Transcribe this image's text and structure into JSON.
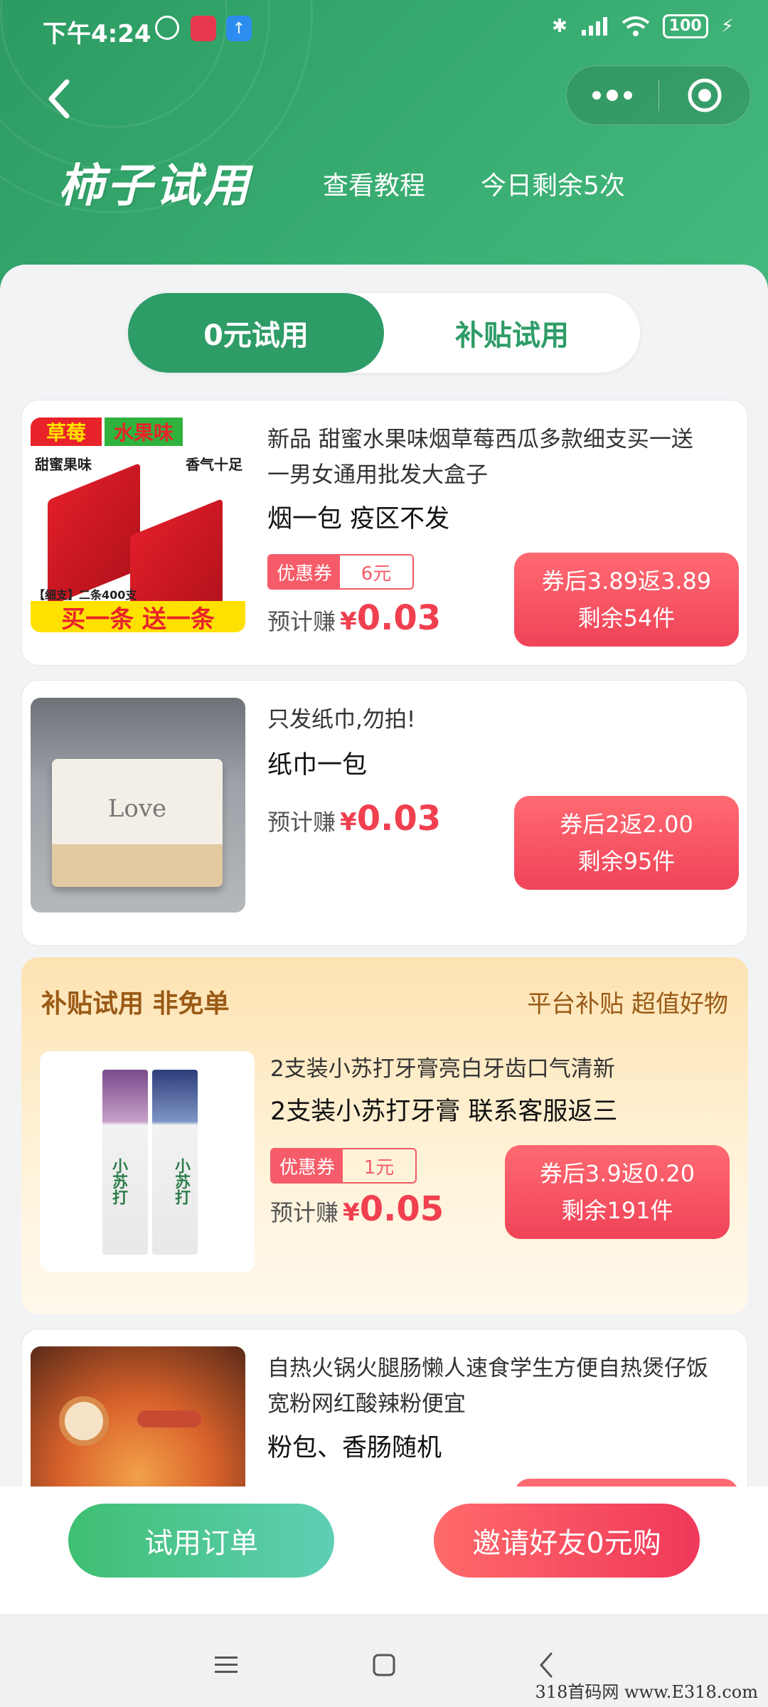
{
  "status_bar": {
    "time": "下午4:24",
    "battery": "100"
  },
  "header": {
    "brand": "柿子试用",
    "tutorial_link": "查看教程",
    "remaining_today": "今日剩余5次"
  },
  "tabs": [
    {
      "label": "0元试用",
      "active": true
    },
    {
      "label": "补贴试用",
      "active": false
    }
  ],
  "products": [
    {
      "title_line1": "新品 甜蜜水果味烟草莓西瓜多款细支买一送",
      "title_line2": "一男女通用批发大盒子",
      "subtitle": "烟一包 疫区不发",
      "coupon_label": "优惠券",
      "coupon_value": "6元",
      "earn_label": "预计赚",
      "currency": "¥",
      "earn_amount": "0.03",
      "btn_line1": "券后3.89返3.89",
      "btn_line2": "剩余54件",
      "image": {
        "tag1": "草莓",
        "tag2": "水果味",
        "left_text": "甜蜜果味",
        "right_text": "香气十足",
        "bottom_small": "【细支】二条400支",
        "banner": "买一条 送一条"
      }
    },
    {
      "title_line1": "只发纸巾,勿拍!",
      "subtitle": "纸巾一包",
      "earn_label": "预计赚",
      "currency": "¥",
      "earn_amount": "0.03",
      "btn_line1": "券后2返2.00",
      "btn_line2": "剩余95件",
      "image": {
        "brand": "Love"
      }
    },
    {
      "title_line1": "2支装小苏打牙膏亮白牙齿口气清新",
      "subtitle": "2支装小苏打牙膏 联系客服返三",
      "coupon_label": "优惠券",
      "coupon_value": "1元",
      "earn_label": "预计赚",
      "currency": "¥",
      "earn_amount": "0.05",
      "btn_line1": "券后3.9返0.20",
      "btn_line2": "剩余191件",
      "image": {
        "label": "小苏打"
      }
    },
    {
      "title_line1": "自热火锅火腿肠懒人速食学生方便自热煲仔饭",
      "title_line2": "宽粉网红酸辣粉便宜",
      "subtitle": "粉包、香肠随机"
    }
  ],
  "subsidy": {
    "title": "补贴试用 非免单",
    "right": "平台补贴 超值好物"
  },
  "bottom": {
    "orders": "试用订单",
    "invite": "邀请好友0元购"
  },
  "watermark": "318首码网 www.E318.com",
  "colors": {
    "primary": "#2e9c67",
    "accent_red": "#f04358",
    "subsidy_text": "#9a5a16"
  }
}
